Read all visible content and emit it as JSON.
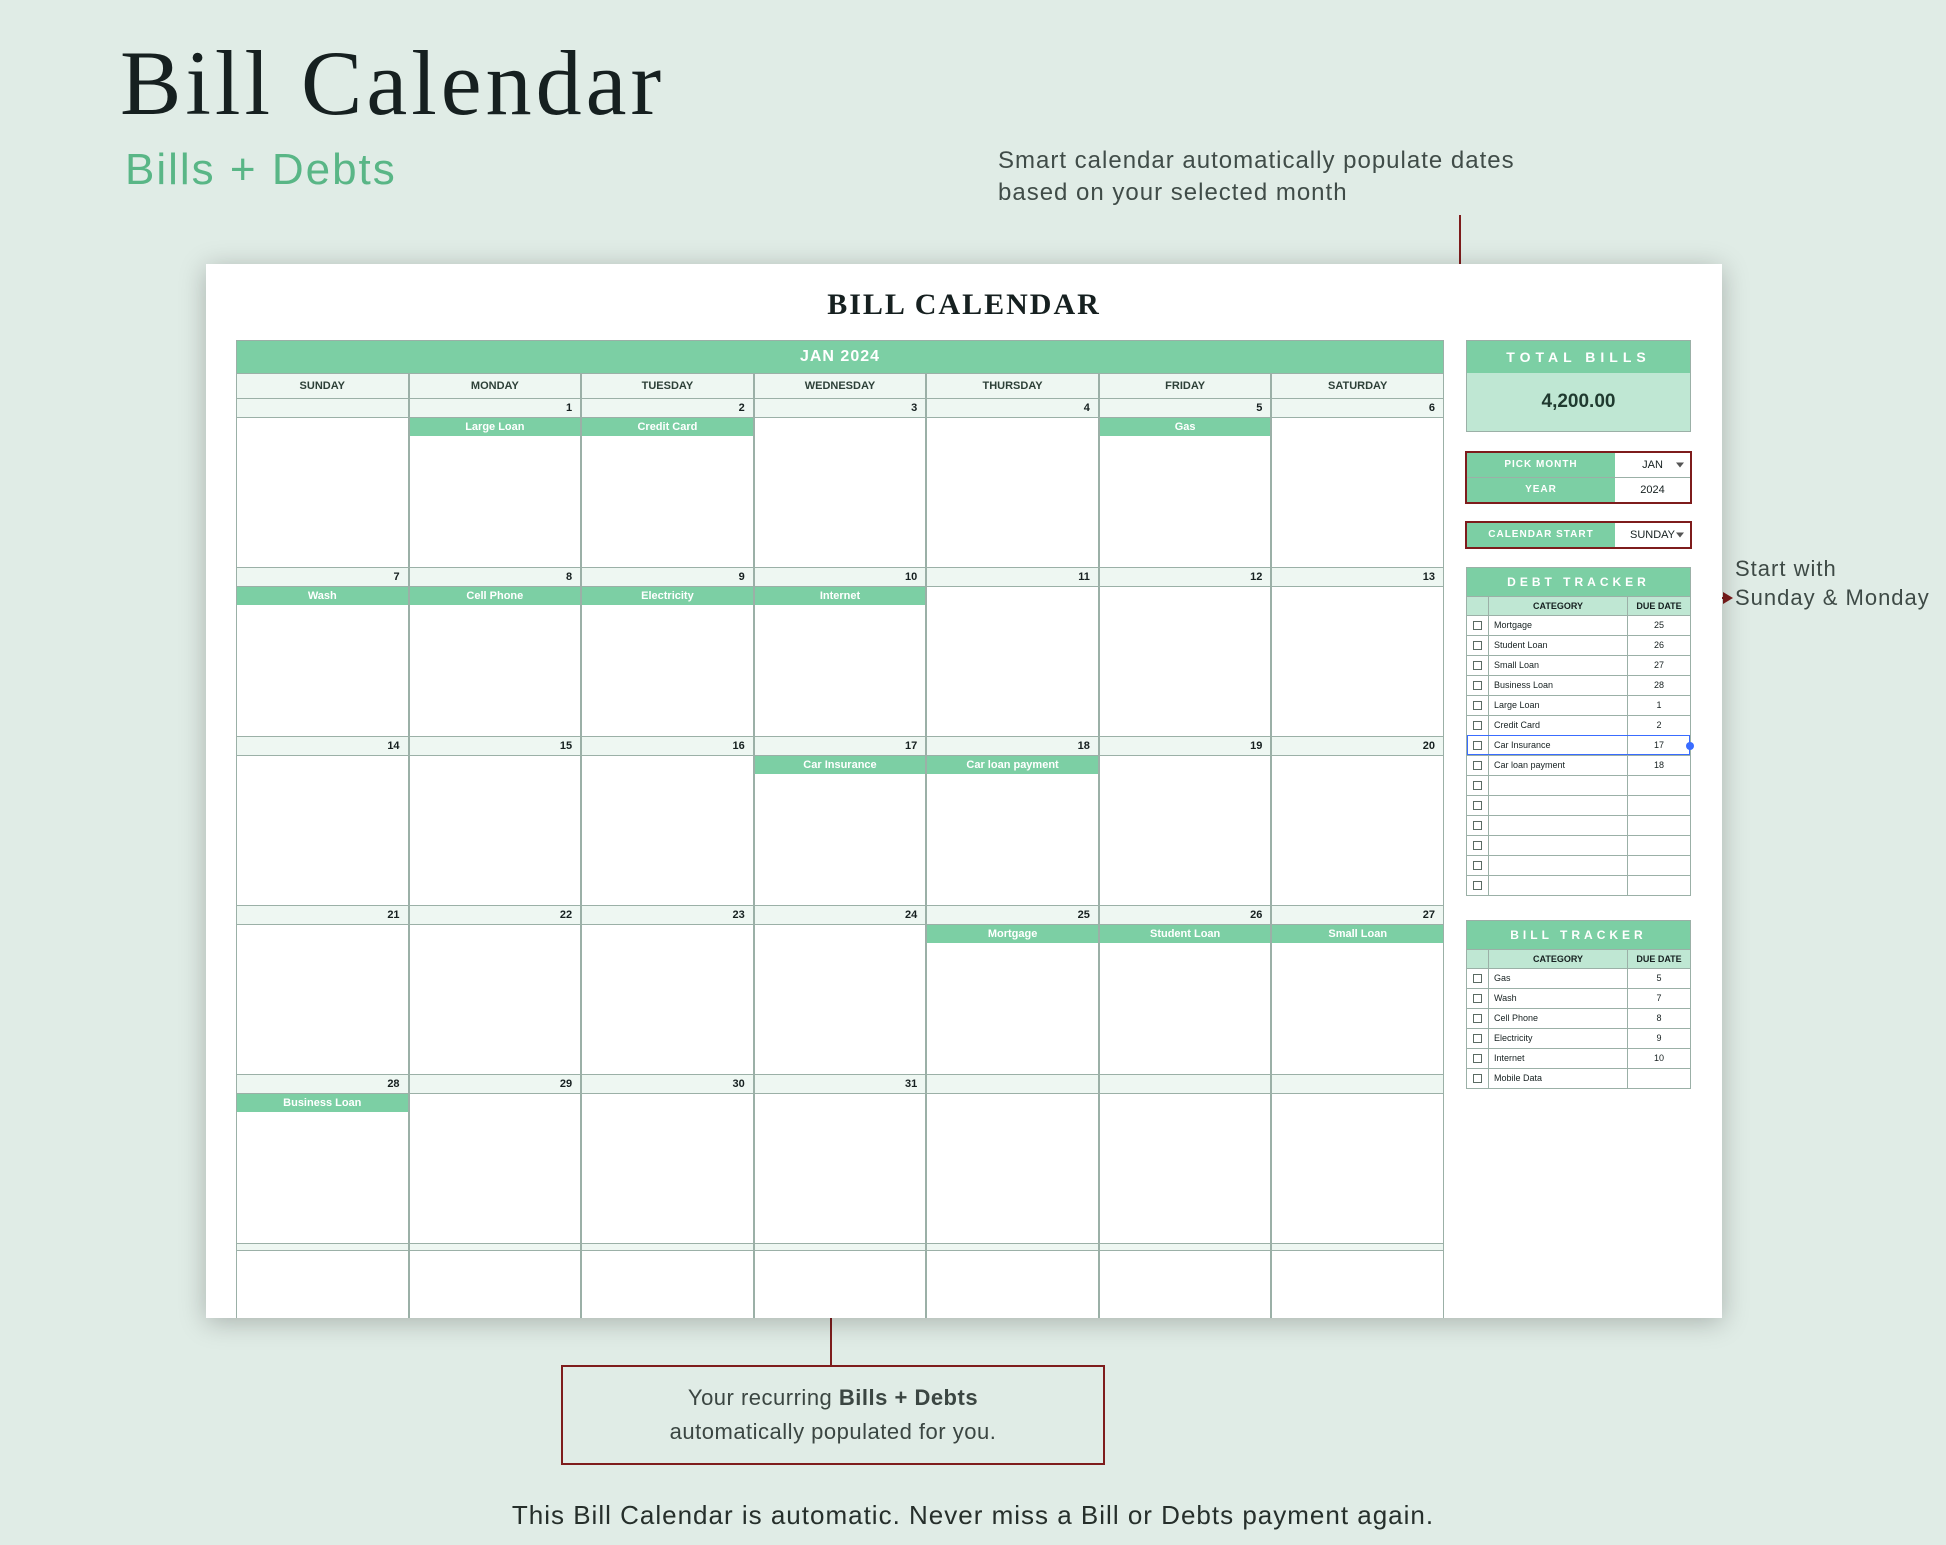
{
  "page": {
    "title": "Bill Calendar",
    "subtitle": "Bills + Debts",
    "callout_top_l1": "Smart calendar automatically populate dates",
    "callout_top_l2": "based on your selected month",
    "callout_right_l1": "Start with",
    "callout_right_l2": "Sunday & Monday",
    "callout_box_plain1": "Your recurring ",
    "callout_box_bold": "Bills + Debts",
    "callout_box_plain2": "automatically populated for you.",
    "bottom_line": "This Bill Calendar is automatic. Never miss a Bill or Debts payment again."
  },
  "sheet": {
    "title": "BILL CALENDAR",
    "month_label": "JAN 2024",
    "days": [
      "SUNDAY",
      "MONDAY",
      "TUESDAY",
      "WEDNESDAY",
      "THURSDAY",
      "FRIDAY",
      "SATURDAY"
    ],
    "weeks": [
      {
        "nums": [
          "",
          "1",
          "2",
          "3",
          "4",
          "5",
          "6"
        ],
        "events": [
          "",
          "Large Loan",
          "Credit Card",
          "",
          "",
          "Gas",
          ""
        ]
      },
      {
        "nums": [
          "7",
          "8",
          "9",
          "10",
          "11",
          "12",
          "13"
        ],
        "events": [
          "Wash",
          "Cell Phone",
          "Electricity",
          "Internet",
          "",
          "",
          ""
        ]
      },
      {
        "nums": [
          "14",
          "15",
          "16",
          "17",
          "18",
          "19",
          "20"
        ],
        "events": [
          "",
          "",
          "",
          "Car Insurance",
          "Car loan payment",
          "",
          ""
        ]
      },
      {
        "nums": [
          "21",
          "22",
          "23",
          "24",
          "25",
          "26",
          "27"
        ],
        "events": [
          "",
          "",
          "",
          "",
          "Mortgage",
          "Student Loan",
          "Small Loan"
        ]
      },
      {
        "nums": [
          "28",
          "29",
          "30",
          "31",
          "",
          "",
          ""
        ],
        "events": [
          "Business Loan",
          "",
          "",
          "",
          "",
          "",
          ""
        ]
      },
      {
        "nums": [
          "",
          "",
          "",
          "",
          "",
          "",
          ""
        ],
        "events": [
          "",
          "",
          "",
          "",
          "",
          "",
          ""
        ]
      }
    ]
  },
  "side": {
    "total_bills_label": "TOTAL BILLS",
    "total_bills_value": "4,200.00",
    "pick_month_label": "PICK MONTH",
    "pick_month_value": "JAN",
    "year_label": "YEAR",
    "year_value": "2024",
    "cal_start_label": "CALENDAR START",
    "cal_start_value": "SUNDAY",
    "debt_tracker": {
      "title": "DEBT TRACKER",
      "col_cat": "CATEGORY",
      "col_due": "DUE DATE",
      "rows": [
        {
          "cat": "Mortgage",
          "due": "25"
        },
        {
          "cat": "Student Loan",
          "due": "26"
        },
        {
          "cat": "Small Loan",
          "due": "27"
        },
        {
          "cat": "Business Loan",
          "due": "28"
        },
        {
          "cat": "Large Loan",
          "due": "1"
        },
        {
          "cat": "Credit Card",
          "due": "2"
        },
        {
          "cat": "Car Insurance",
          "due": "17",
          "selected": true
        },
        {
          "cat": "Car loan payment",
          "due": "18"
        },
        {
          "cat": "",
          "due": ""
        },
        {
          "cat": "",
          "due": ""
        },
        {
          "cat": "",
          "due": ""
        },
        {
          "cat": "",
          "due": ""
        },
        {
          "cat": "",
          "due": ""
        },
        {
          "cat": "",
          "due": ""
        }
      ]
    },
    "bill_tracker": {
      "title": "BILL TRACKER",
      "col_cat": "CATEGORY",
      "col_due": "DUE DATE",
      "rows": [
        {
          "cat": "Gas",
          "due": "5"
        },
        {
          "cat": "Wash",
          "due": "7"
        },
        {
          "cat": "Cell Phone",
          "due": "8"
        },
        {
          "cat": "Electricity",
          "due": "9"
        },
        {
          "cat": "Internet",
          "due": "10"
        },
        {
          "cat": "Mobile Data",
          "due": ""
        }
      ]
    }
  }
}
